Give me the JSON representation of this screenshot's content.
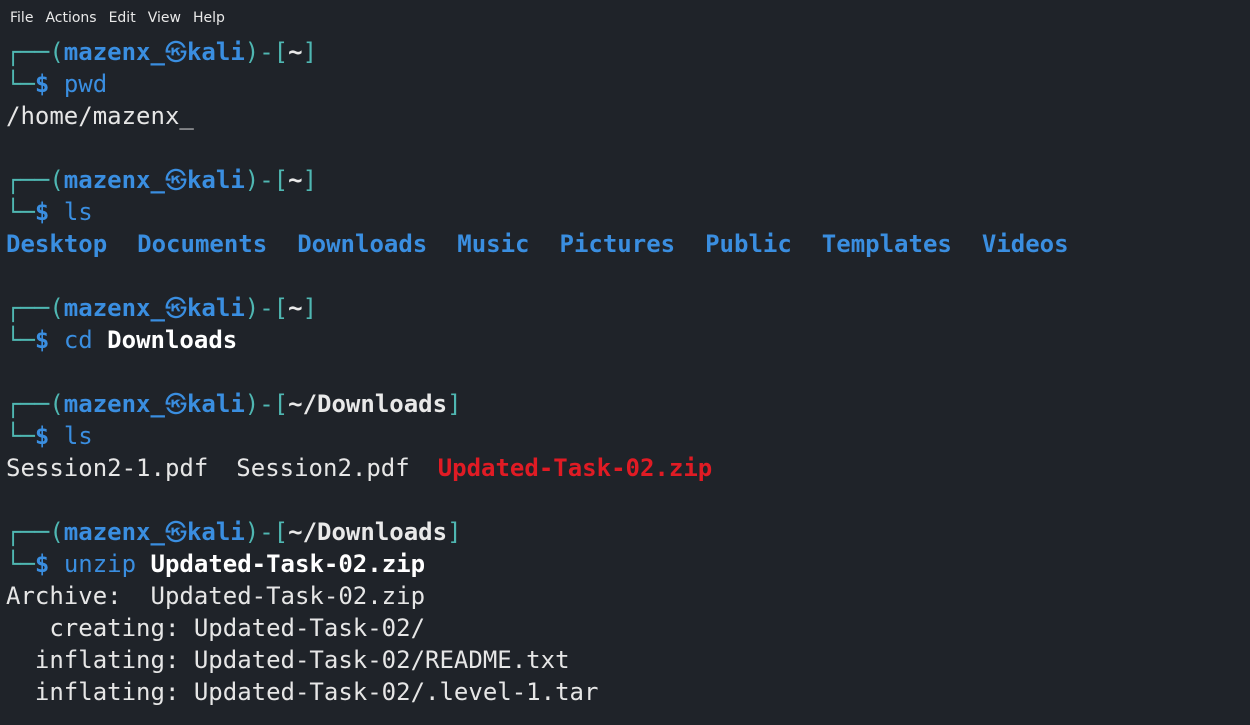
{
  "menu": [
    "File",
    "Actions",
    "Edit",
    "View",
    "Help"
  ],
  "prompt": {
    "top_left": "┌──(",
    "user": "mazenx_",
    "skull": "㉿",
    "host": "kali",
    "mid": ")-[",
    "close": "]",
    "bottom_left": "└─",
    "dollar": "$"
  },
  "blocks": [
    {
      "dir": "~",
      "cmd": "pwd",
      "arg": "",
      "output": [
        "/home/mazenx_"
      ]
    },
    {
      "dir": "~",
      "cmd": "ls",
      "arg": "",
      "folders": [
        "Desktop",
        "Documents",
        "Downloads",
        "Music",
        "Pictures",
        "Public",
        "Templates",
        "Videos"
      ]
    },
    {
      "dir": "~",
      "cmd": "cd",
      "arg": "Downloads"
    },
    {
      "dir": "~/Downloads",
      "cmd": "ls",
      "arg": "",
      "files": [
        "Session2-1.pdf",
        "Session2.pdf"
      ],
      "zip": "Updated-Task-02.zip"
    },
    {
      "dir": "~/Downloads",
      "cmd": "unzip",
      "arg": "Updated-Task-02.zip",
      "output": [
        "Archive:  Updated-Task-02.zip",
        "   creating: Updated-Task-02/",
        "  inflating: Updated-Task-02/README.txt",
        "  inflating: Updated-Task-02/.level-1.tar"
      ]
    }
  ],
  "colors": {
    "background": "#1f2329",
    "prompt_user": "#3a8ee0",
    "prompt_frame": "#4fb7b2",
    "zip_file": "#e01b24"
  }
}
